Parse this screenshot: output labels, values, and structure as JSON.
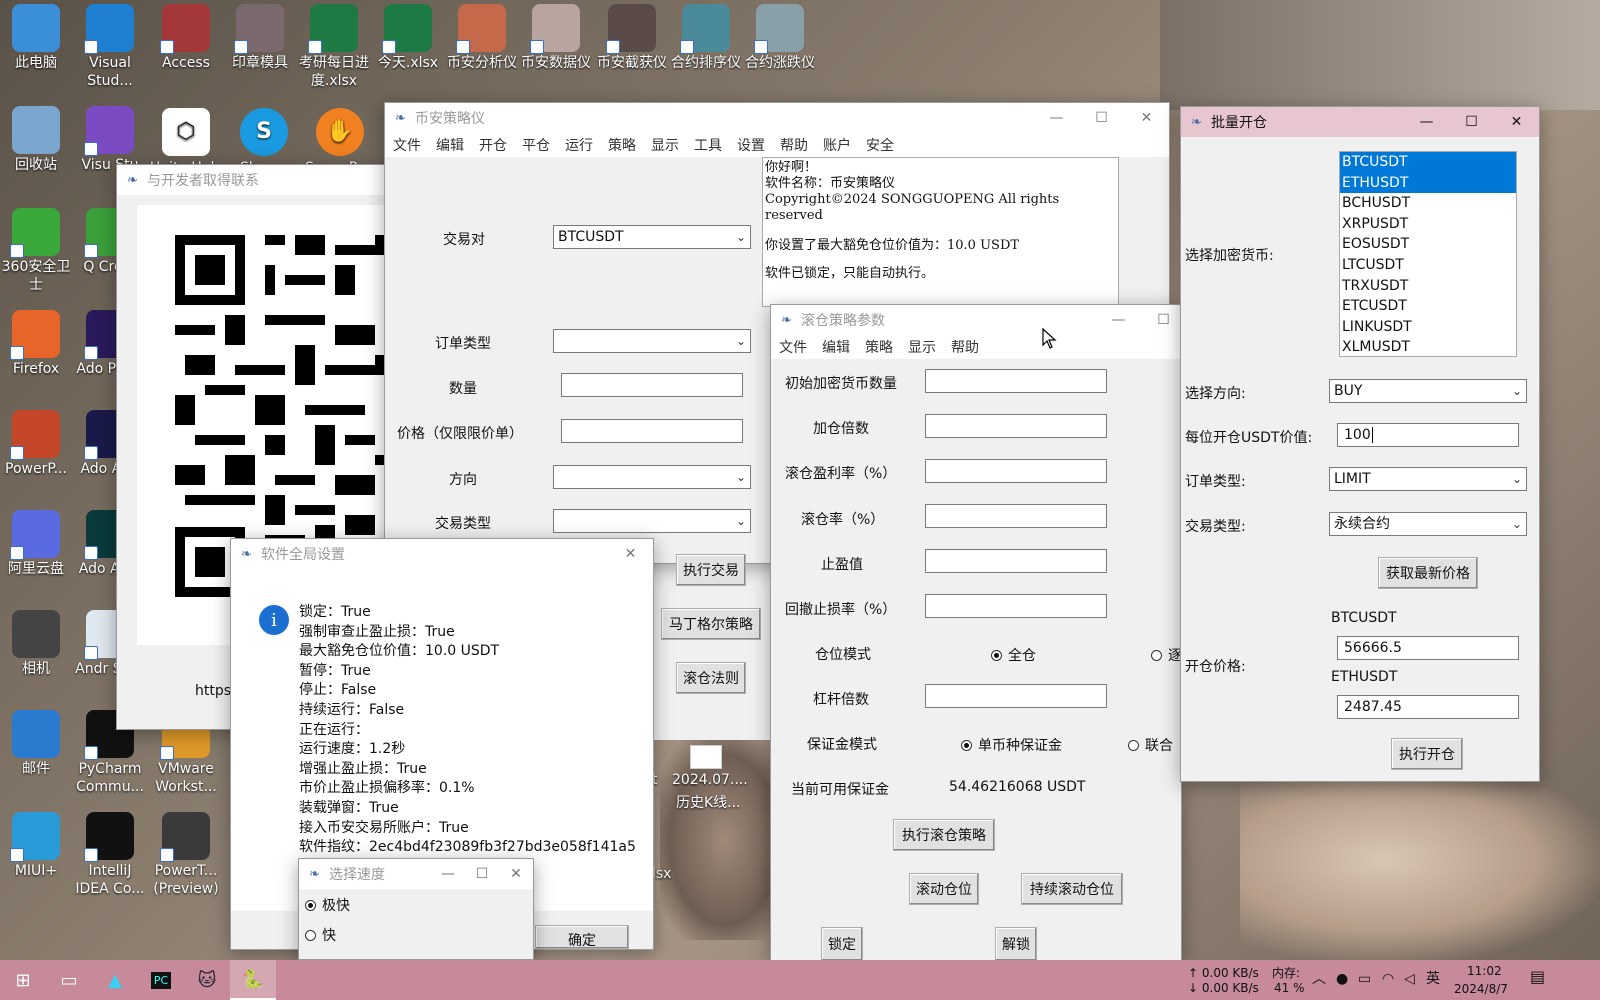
{
  "desktop_icons": [
    {
      "label": "此电脑",
      "icon": "computer-icon",
      "color": "#3a8fd8"
    },
    {
      "label": "Visual Stud...",
      "icon": "vscode-icon",
      "color": "#1f7fd0"
    },
    {
      "label": "Access",
      "icon": "access-icon",
      "color": "#a4373a"
    },
    {
      "label": "印章模具",
      "icon": "seal-icon",
      "color": "#7a6a70"
    },
    {
      "label": "考研每日进度.xlsx",
      "icon": "excel-icon",
      "color": "#1d7a45"
    },
    {
      "label": "今天.xlsx",
      "icon": "excel-icon",
      "color": "#1d7a45"
    },
    {
      "label": "币安分析仪",
      "icon": "app-icon",
      "color": "#c46a4a"
    },
    {
      "label": "币安数据仪",
      "icon": "app-icon",
      "color": "#b8a5a0"
    },
    {
      "label": "币安截获仪",
      "icon": "app-icon",
      "color": "#5a4a48"
    },
    {
      "label": "合约排序仪",
      "icon": "app-icon",
      "color": "#4a8a9a"
    },
    {
      "label": "合约涨跌仪",
      "icon": "app-icon",
      "color": "#8aa0a8"
    },
    {
      "label": "回收站",
      "icon": "recycle-bin-icon",
      "color": "#7aa6d0"
    },
    {
      "label": "Visu Stu",
      "icon": "visual-studio-icon",
      "color": "#7a4bc2"
    },
    {
      "label": "360安全卫士",
      "icon": "360-icon",
      "color": "#3aa83a"
    },
    {
      "label": "Q Creat",
      "icon": "qt-icon",
      "color": "#3aa03a"
    },
    {
      "label": "Firefox",
      "icon": "firefox-icon",
      "color": "#e8652a"
    },
    {
      "label": "Ado Prem",
      "icon": "premiere-icon",
      "color": "#2a1a5a"
    },
    {
      "label": "PowerP...",
      "icon": "powerpoint-icon",
      "color": "#c4472a"
    },
    {
      "label": "Ado Afte",
      "icon": "after-effects-icon",
      "color": "#1a1a4a"
    },
    {
      "label": "阿里云盘",
      "icon": "aliyun-icon",
      "color": "#5a6ae0"
    },
    {
      "label": "Ado Audi",
      "icon": "audition-icon",
      "color": "#0a3a3a"
    },
    {
      "label": "相机",
      "icon": "camera-icon",
      "color": "#444"
    },
    {
      "label": "Andr Stud",
      "icon": "android-studio-icon",
      "color": "#e0e8f0"
    },
    {
      "label": "邮件",
      "icon": "mail-icon",
      "color": "#2a7ad0"
    },
    {
      "label": "PyCharm Commu...",
      "icon": "pycharm-icon",
      "color": "#111"
    },
    {
      "label": "VMware Workst...",
      "icon": "vmware-icon",
      "color": "#e09a2a"
    },
    {
      "label": "MIUI+",
      "icon": "miui-icon",
      "color": "#2a9ad8"
    },
    {
      "label": "IntelliJ IDEA Co...",
      "icon": "intellij-icon",
      "color": "#111"
    },
    {
      "label": "PowerT... (Preview)",
      "icon": "powertoys-icon",
      "color": "#3a3a3a"
    }
  ],
  "top_row_partial": [
    "Unity Hub",
    "Sk",
    "SunnyR"
  ],
  "desktop_file_partial": {
    "line1": "2024.07....",
    "line2": "历史K线...",
    "ext": "lsx",
    "t": "t"
  },
  "contact_window": {
    "title": "与开发者取得联系",
    "url_partial": "https"
  },
  "main_window": {
    "title": "币安策略仪",
    "menu": [
      "文件",
      "编辑",
      "开仓",
      "平仓",
      "运行",
      "策略",
      "显示",
      "工具",
      "设置",
      "帮助",
      "账户",
      "安全"
    ],
    "labels": {
      "pair": "交易对",
      "order_type": "订单类型",
      "quantity": "数量",
      "price": "价格（仅限限价单）",
      "direction": "方向",
      "trade_type": "交易类型"
    },
    "pair_value": "BTCUSDT",
    "buttons": {
      "execute": "执行交易",
      "martingale": "马丁格尔策略",
      "rolling_rule": "滚仓法则"
    },
    "log_lines": [
      "你好啊！",
      "软件名称：币安策略仪",
      "Copyright©2024 SONGGUOPENG All rights",
      "reserved",
      "",
      "你设置了最大豁免仓位价值为：10.0 USDT",
      "软件已锁定，只能自动执行。"
    ]
  },
  "settings_window": {
    "title": "软件全局设置",
    "lines": [
      "锁定：True",
      "强制审查止盈止损：True",
      "最大豁免仓位价值：10.0 USDT",
      "暂停：True",
      "停止：False",
      "持续运行：False",
      "正在运行：",
      "运行速度：1.2秒",
      "增强止盈止损：True",
      "市价止盈止损偏移率：0.1%",
      "装载弹窗：True",
      "接入币安交易所账户：True",
      "软件指纹：2ec4bd4f23089fb3f27bd3e058f141a5"
    ],
    "ok_partial": "确定"
  },
  "speed_window": {
    "title": "选择速度",
    "options": [
      "极快",
      "快"
    ]
  },
  "rolling_window": {
    "title": "滚仓策略参数",
    "menu": [
      "文件",
      "编辑",
      "策略",
      "显示",
      "帮助"
    ],
    "labels": {
      "initial_qty": "初始加密货币数量",
      "multiplier": "加仓倍数",
      "profit_rate": "滚仓盈利率（%）",
      "roll_rate": "滚仓率（%）",
      "take_profit": "止盈值",
      "drawdown": "回撤止损率（%）",
      "position_mode": "仓位模式",
      "leverage": "杠杆倍数",
      "margin_mode": "保证金模式",
      "available_margin": "当前可用保证金"
    },
    "position_options": [
      "全仓",
      "逐"
    ],
    "margin_options": [
      "单币种保证金",
      "联合"
    ],
    "available_margin_value": "54.46216068 USDT",
    "buttons": {
      "execute": "执行滚仓策略",
      "roll": "滚动仓位",
      "continuous": "持续滚动仓位",
      "lock_partial": "锁定",
      "unlock_partial": "解锁"
    }
  },
  "batch_window": {
    "title": "批量开仓",
    "labels": {
      "select_coin": "选择加密货币:",
      "direction": "选择方向:",
      "usdt_value": "每位开仓USDT价值:",
      "order_type": "订单类型:",
      "trade_type": "交易类型:",
      "open_price": "开仓价格:"
    },
    "coins": [
      "BTCUSDT",
      "ETHUSDT",
      "BCHUSDT",
      "XRPUSDT",
      "EOSUSDT",
      "LTCUSDT",
      "TRXUSDT",
      "ETCUSDT",
      "LINKUSDT",
      "XLMUSDT"
    ],
    "selected": [
      "BTCUSDT",
      "ETHUSDT"
    ],
    "direction_value": "BUY",
    "usdt_value": "100",
    "order_type_value": "LIMIT",
    "trade_type_value": "永续合约",
    "fetch_button": "获取最新价格",
    "prices": [
      {
        "symbol": "BTCUSDT",
        "price": "56666.5"
      },
      {
        "symbol": "ETHUSDT",
        "price": "2487.45"
      }
    ],
    "execute_button": "执行开仓"
  },
  "taskbar": {
    "net_up": "↑ 0.00 KB/s",
    "net_down": "↓ 0.00 KB/s",
    "mem_label": "内存:",
    "mem_value": "41 %",
    "ime": "英",
    "time": "11:02",
    "date": "2024/8/7"
  },
  "colors": {
    "taskbar": "#c68a9a",
    "batch_titlebar": "#e8c6cf",
    "selection": "#0078d7",
    "info_icon": "#1a6fd0"
  }
}
